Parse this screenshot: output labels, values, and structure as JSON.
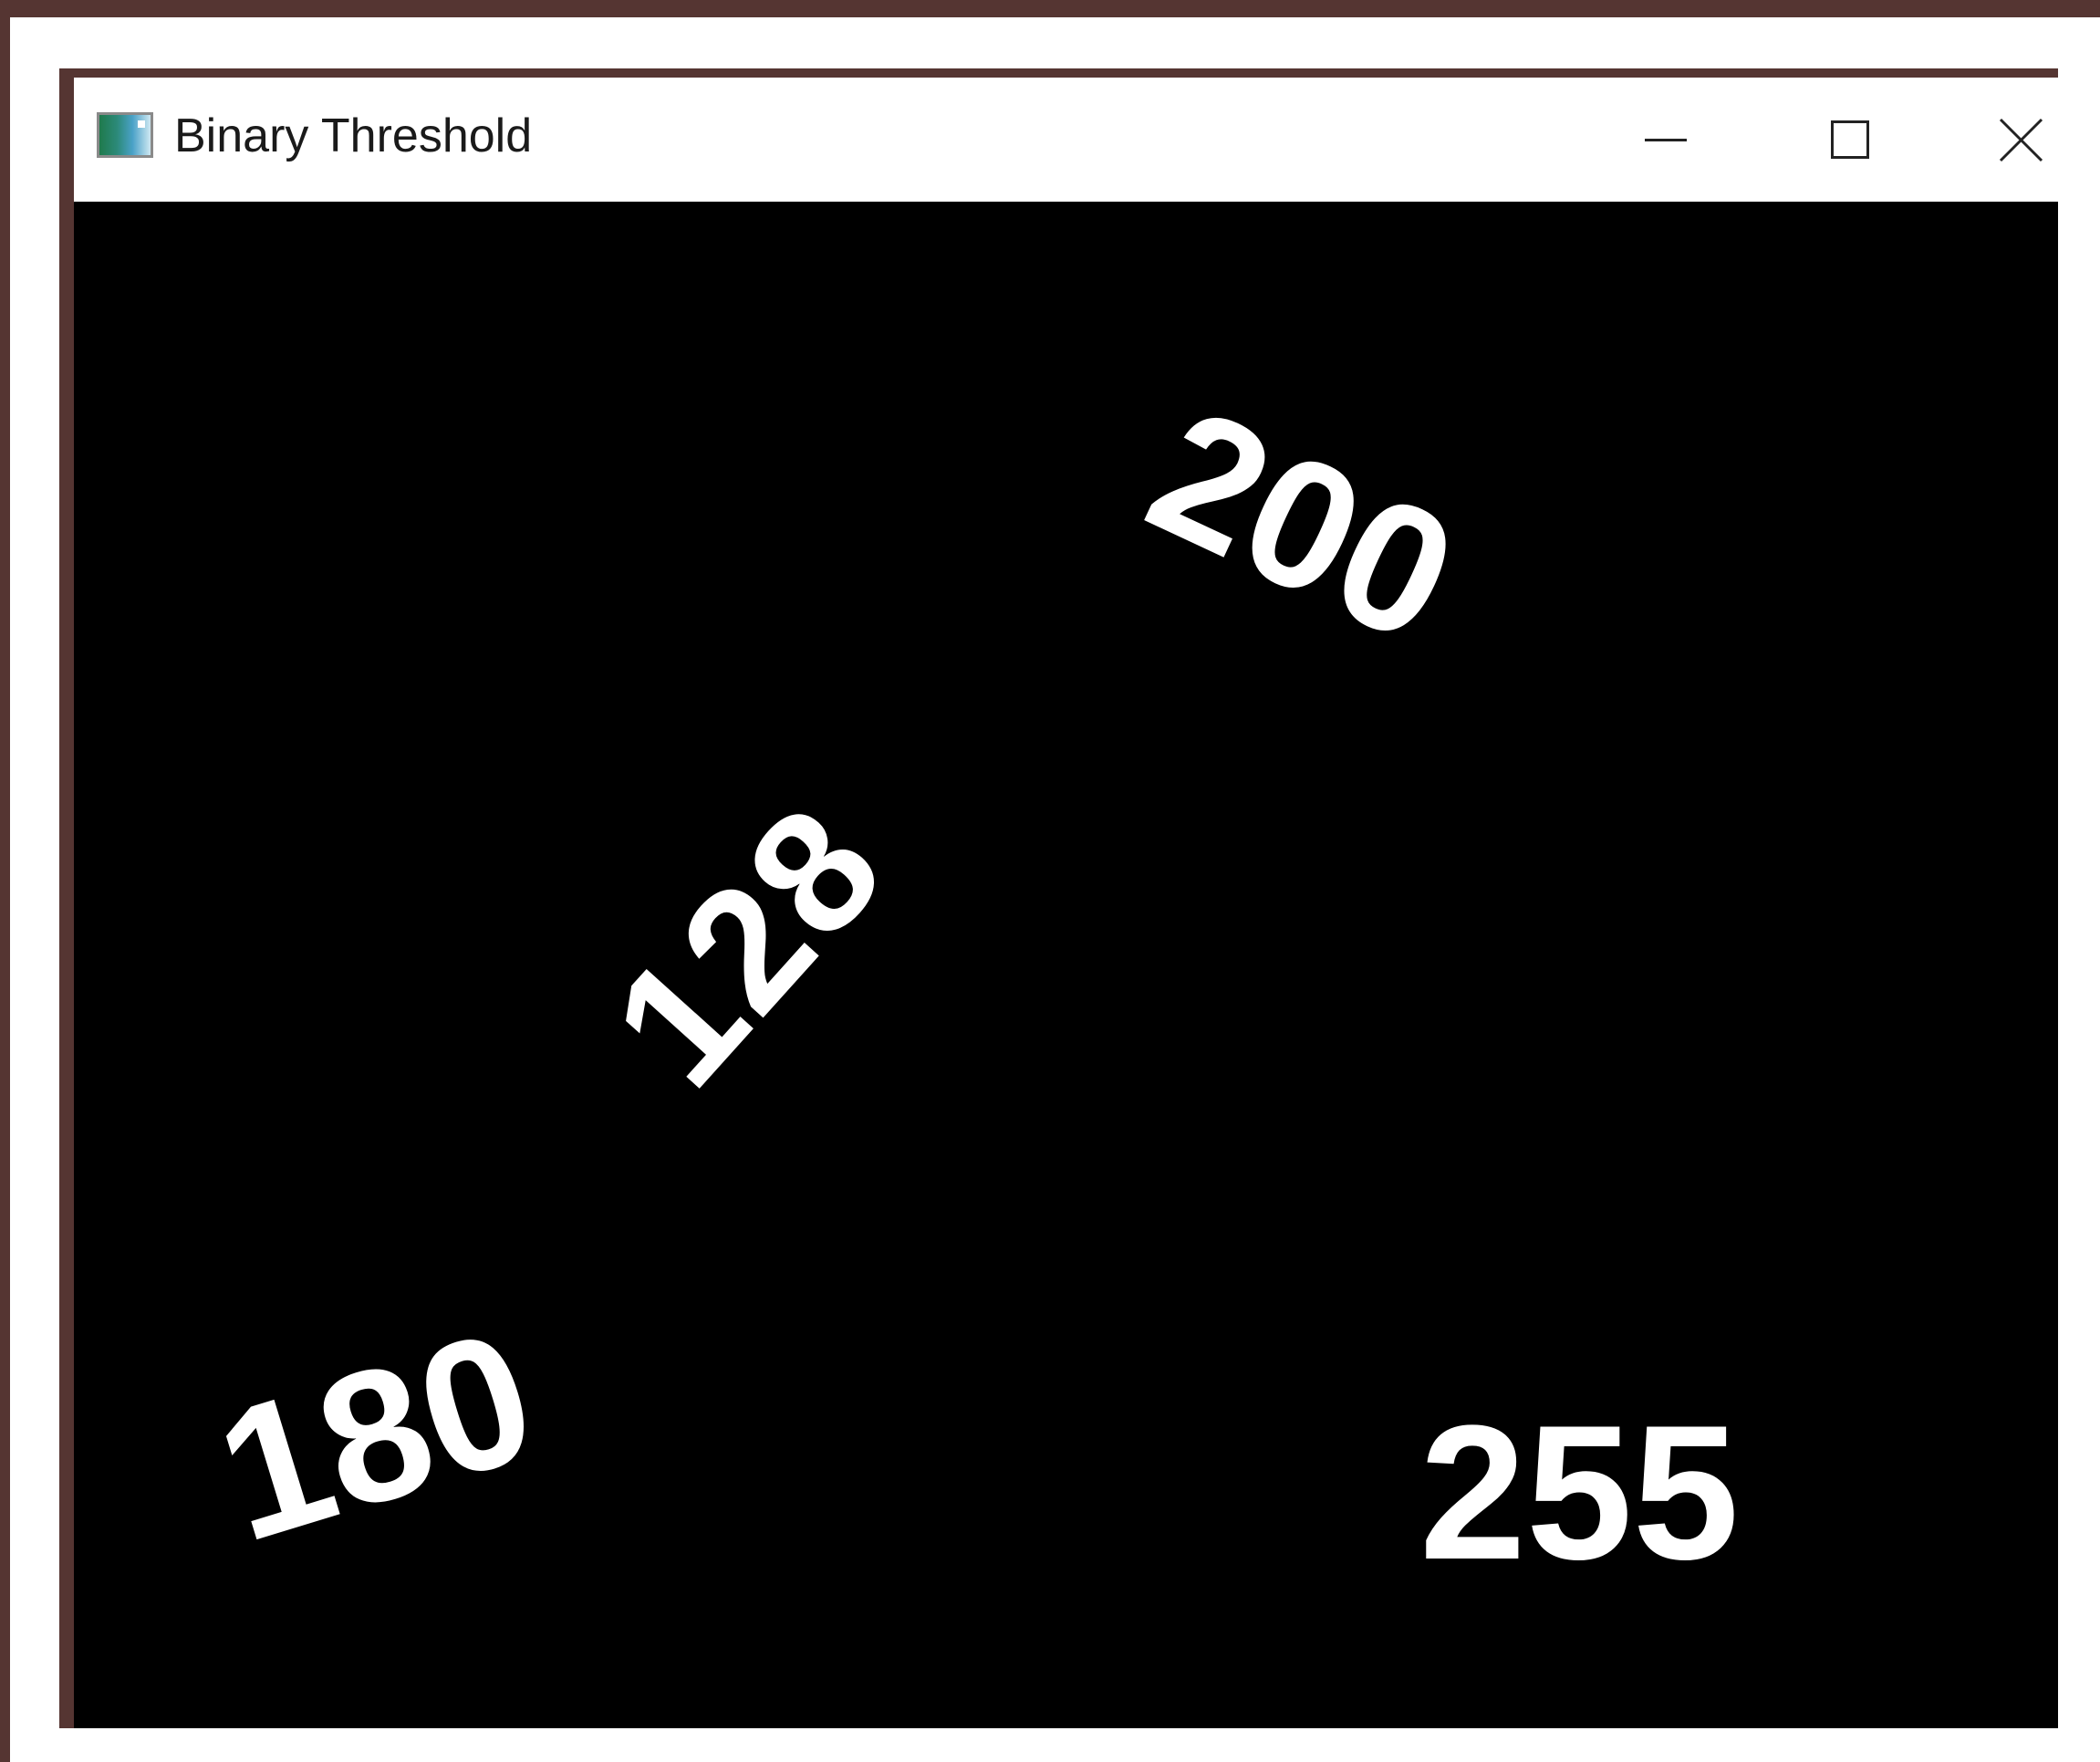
{
  "window": {
    "title": "Binary Threshold",
    "icon": "app-window-icon"
  },
  "title_controls": {
    "minimize": "minimize-icon",
    "maximize": "maximize-icon",
    "close": "close-icon"
  },
  "image": {
    "background": "#000000",
    "foreground": "#ffffff",
    "numbers": [
      "200",
      "128",
      "180",
      "255"
    ]
  }
}
